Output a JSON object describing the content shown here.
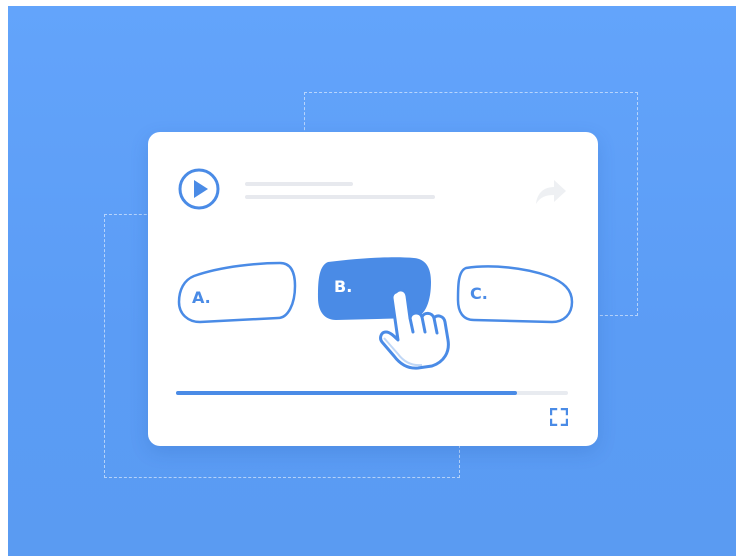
{
  "colors": {
    "background": "#5b9cf5",
    "card": "#ffffff",
    "accent": "#4a8be6",
    "muted_line": "#e7e9ee"
  },
  "player": {
    "play_icon": "play-circle-icon",
    "share_icon": "share-arrow-icon",
    "fullscreen_icon": "fullscreen-icon",
    "progress": 0.87
  },
  "options": [
    {
      "label": "A.",
      "selected": false
    },
    {
      "label": "B.",
      "selected": true
    },
    {
      "label": "C.",
      "selected": false
    }
  ],
  "pointer_icon": "hand-pointer-icon"
}
